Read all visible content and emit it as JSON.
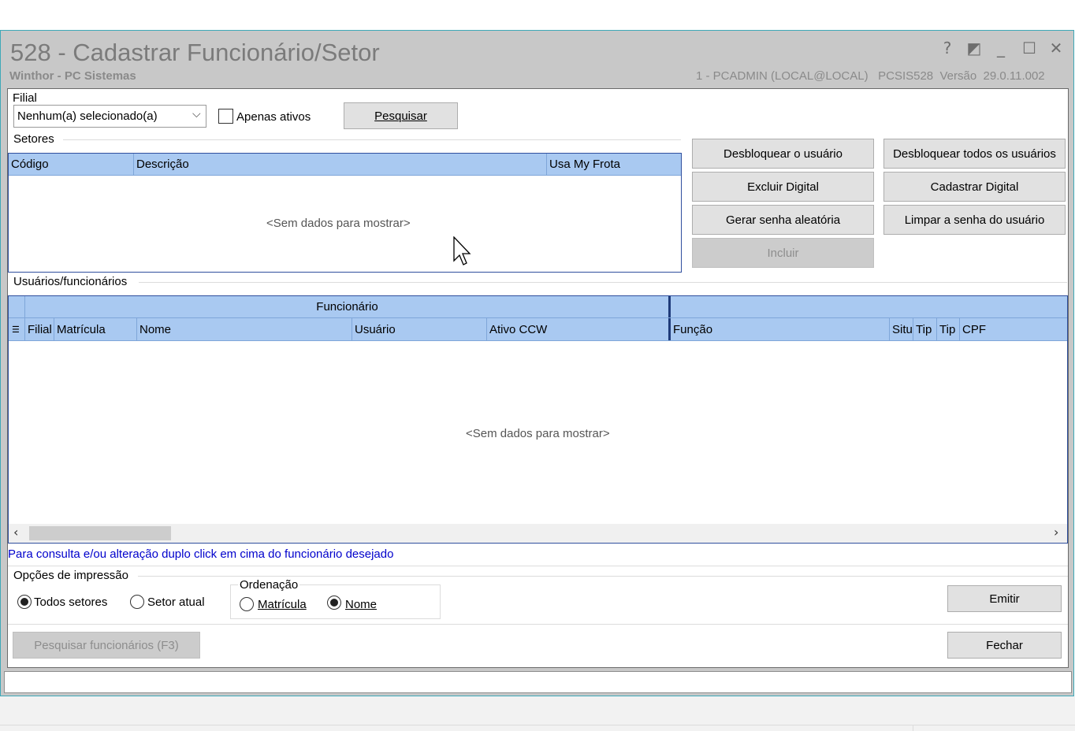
{
  "window": {
    "title": "528 - Cadastrar Funcionário/Setor",
    "subtitle": "Winthor - PC Sistemas",
    "session_info": "1 - PCADMIN (LOCAL@LOCAL)   PCSIS528  Versão  29.0.11.002",
    "controls": {
      "help": "?",
      "restore": "◩",
      "minimize": "_",
      "maximize": "☐",
      "close": "✕"
    }
  },
  "filter": {
    "filial_label": "Filial",
    "filial_value": "Nenhum(a) selecionado(a)",
    "apenas_ativos_label": "Apenas ativos",
    "apenas_ativos_checked": false,
    "search_button": "Pesquisar"
  },
  "setores": {
    "group_label": "Setores",
    "columns": [
      "Código",
      "Descrição",
      "Usa My Frota"
    ],
    "empty_message": "<Sem dados para mostrar>"
  },
  "actions": {
    "desbloquear": "Desbloquear o usuário",
    "desbloquear_todos": "Desbloquear todos os usuários",
    "excluir_digital": "Excluir Digital",
    "cadastrar_digital": "Cadastrar Digital",
    "gerar_senha": "Gerar senha aleatória",
    "limpar_senha": "Limpar a senha do usuário",
    "incluir": "Incluir"
  },
  "usuarios": {
    "group_label": "Usuários/funcionários",
    "band_funcionario": "Funcionário",
    "columns": [
      "Filial",
      "Matrícula",
      "Nome",
      "Usuário",
      "Ativo CCW",
      "Função",
      "Situ",
      "Tip",
      "Tip",
      "CPF"
    ],
    "empty_message": "<Sem dados para mostrar>",
    "hint": "Para consulta e/ou alteração duplo click em cima do funcionário desejado"
  },
  "print_options": {
    "group_label": "Opções de impressão",
    "todos_setores": "Todos setores",
    "setor_atual": "Setor atual",
    "selected": "Todos setores"
  },
  "ordering": {
    "group_label": "Ordenação",
    "matricula": "Matrícula",
    "nome": "Nome",
    "selected": "Nome"
  },
  "footer": {
    "pesquisar_funcionarios": "Pesquisar funcionários (F3)",
    "emitir": "Emitir",
    "fechar": "Fechar"
  },
  "colors": {
    "grid_header": "#a9c9f1",
    "grid_border": "#2f4f9e",
    "hint_text": "#0000cc",
    "window_frame": "#c8c8c8",
    "window_border": "#3ea9b8"
  }
}
